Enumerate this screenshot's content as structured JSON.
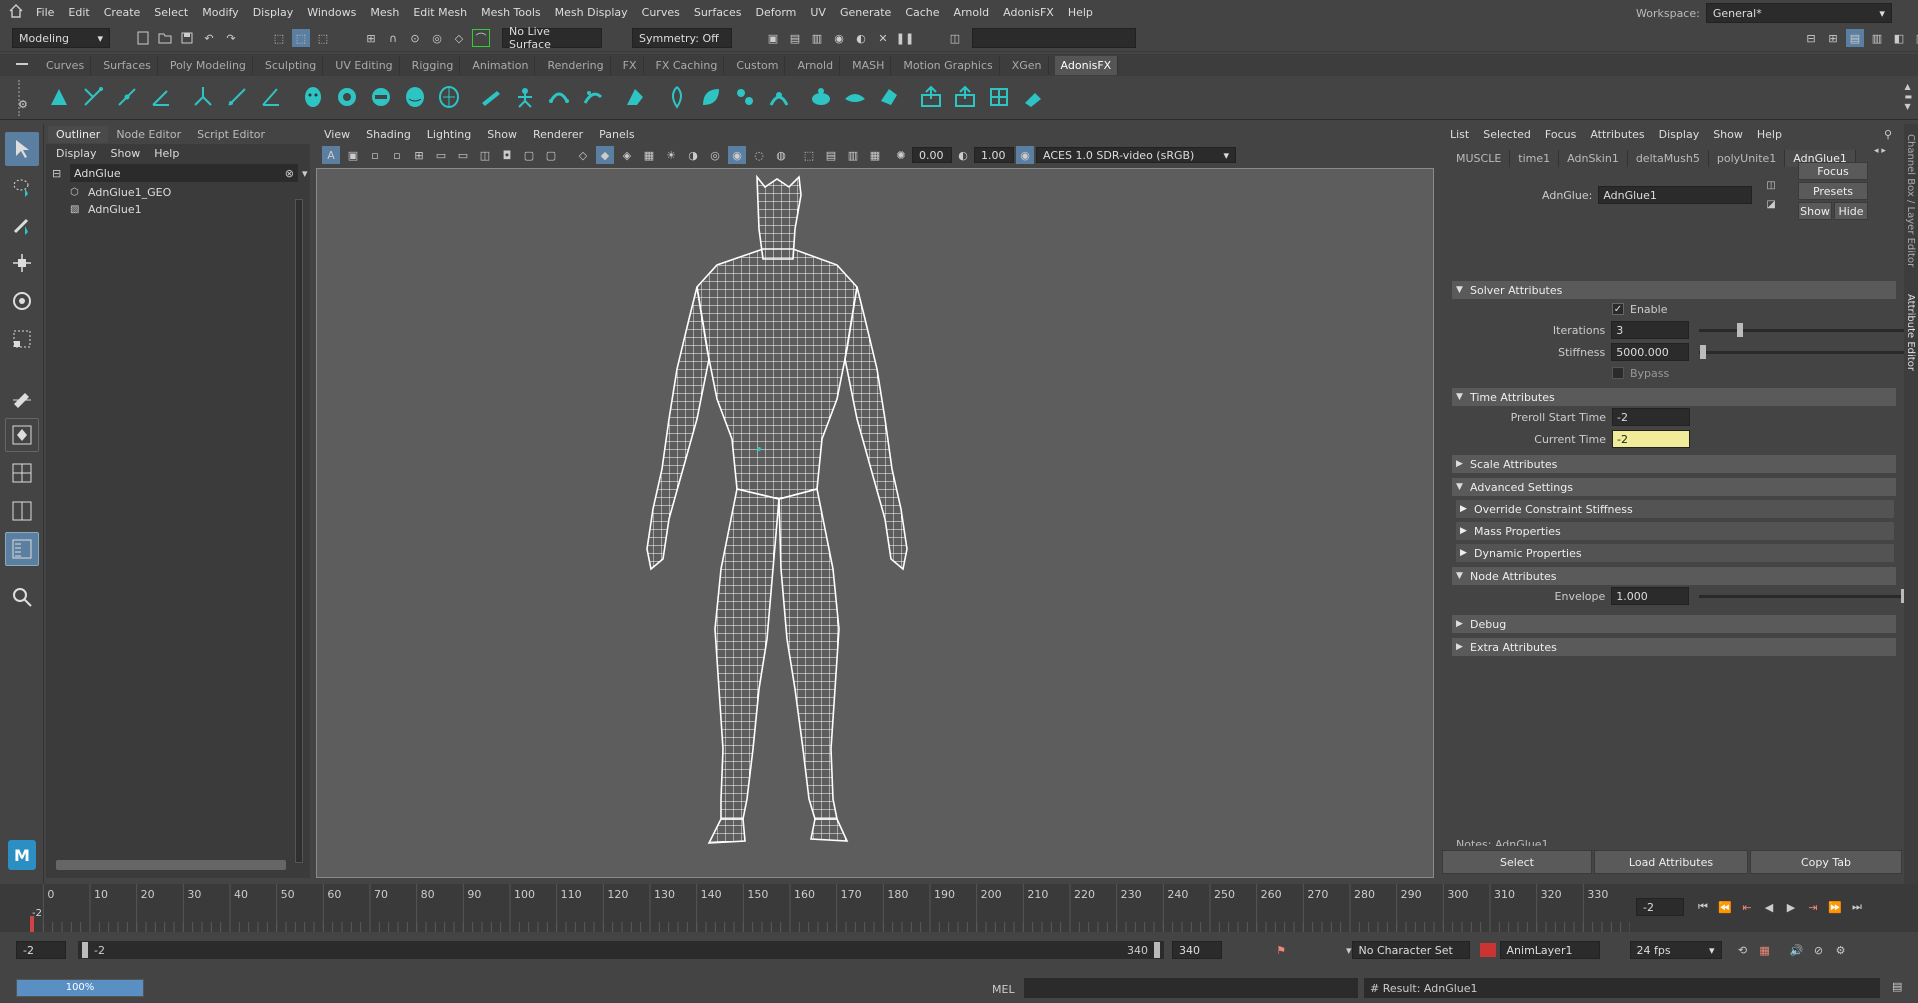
{
  "menubar": {
    "items": [
      "File",
      "Edit",
      "Create",
      "Select",
      "Modify",
      "Display",
      "Windows",
      "Mesh",
      "Edit Mesh",
      "Mesh Tools",
      "Mesh Display",
      "Curves",
      "Surfaces",
      "Deform",
      "UV",
      "Generate",
      "Cache",
      "Arnold",
      "AdonisFX",
      "Help"
    ],
    "workspace_label": "Workspace:",
    "workspace_value": "General*"
  },
  "statusline": {
    "mode": "Modeling",
    "live_surface": "No Live Surface",
    "symmetry": "Symmetry: Off"
  },
  "shelf": {
    "tabs": [
      "Curves",
      "Surfaces",
      "Poly Modeling",
      "Sculpting",
      "UV Editing",
      "Rigging",
      "Animation",
      "Rendering",
      "FX",
      "FX Caching",
      "Custom",
      "Arnold",
      "MASH",
      "Motion Graphics",
      "XGen",
      "AdonisFX"
    ],
    "active_tab": "AdonisFX",
    "accent": "#2ec4c4"
  },
  "outliner": {
    "tabs": [
      "Outliner",
      "Node Editor",
      "Script Editor"
    ],
    "menu": [
      "Display",
      "Show",
      "Help"
    ],
    "search_value": "AdnGlue",
    "items": [
      {
        "label": "AdnGlue1_GEO",
        "icon": "mesh-icon"
      },
      {
        "label": "AdnGlue1",
        "icon": "deformer-icon"
      }
    ]
  },
  "viewport": {
    "menu": [
      "View",
      "Shading",
      "Lighting",
      "Show",
      "Renderer",
      "Panels"
    ],
    "field1": "0.00",
    "field2": "1.00",
    "colorspace": "ACES 1.0 SDR-video (sRGB)"
  },
  "attribute_editor": {
    "menu": [
      "List",
      "Selected",
      "Focus",
      "Attributes",
      "Display",
      "Show",
      "Help"
    ],
    "tabs": [
      "MUSCLE",
      "time1",
      "AdnSkin1",
      "deltaMush5",
      "polyUnite1",
      "AdnGlue1"
    ],
    "active_tab": "AdnGlue1",
    "node_label": "AdnGlue:",
    "node_name": "AdnGlue1",
    "side_buttons": {
      "focus": "Focus",
      "presets": "Presets",
      "show": "Show",
      "hide": "Hide"
    },
    "solver": {
      "title": "Solver Attributes",
      "enable_label": "Enable",
      "enable": true,
      "iterations_label": "Iterations",
      "iterations": "3",
      "iterations_level": 0.2,
      "stiffness_label": "Stiffness",
      "stiffness": "5000.000",
      "stiffness_level": 0.02,
      "bypass_label": "Bypass",
      "bypass": false
    },
    "time": {
      "title": "Time Attributes",
      "preroll_label": "Preroll Start Time",
      "preroll": "-2",
      "current_label": "Current Time",
      "current": "-2"
    },
    "scale_title": "Scale Attributes",
    "advanced_title": "Advanced Settings",
    "advanced_subs": [
      "Override Constraint Stiffness",
      "Mass Properties",
      "Dynamic Properties"
    ],
    "node_attrs": {
      "title": "Node Attributes",
      "envelope_label": "Envelope",
      "envelope": "1.000",
      "envelope_level": 1.0
    },
    "debug_title": "Debug",
    "extra_title": "Extra Attributes",
    "notes": "Notes: AdnGlue1",
    "bottom_buttons": {
      "select": "Select",
      "load": "Load Attributes",
      "copy": "Copy Tab"
    },
    "side_tabs": {
      "channel": "Channel Box / Layer Editor",
      "attr": "Attribute Editor"
    }
  },
  "timeline": {
    "ticks": [
      "0",
      "10",
      "20",
      "30",
      "40",
      "50",
      "60",
      "70",
      "80",
      "90",
      "100",
      "110",
      "120",
      "130",
      "140",
      "150",
      "160",
      "170",
      "180",
      "190",
      "200",
      "210",
      "220",
      "230",
      "240",
      "250",
      "260",
      "270",
      "280",
      "290",
      "300",
      "310",
      "320",
      "330"
    ],
    "current_marker": "-2",
    "current_frame_field": "-2"
  },
  "range": {
    "start": "-2",
    "inner_start": "-2",
    "inner_end": "340",
    "end": "340",
    "character_set": "No Character Set",
    "anim_layer": "AnimLayer1",
    "fps": "24 fps"
  },
  "cmdline": {
    "progress": "100%",
    "lang": "MEL",
    "result": "# Result: AdnGlue1"
  }
}
